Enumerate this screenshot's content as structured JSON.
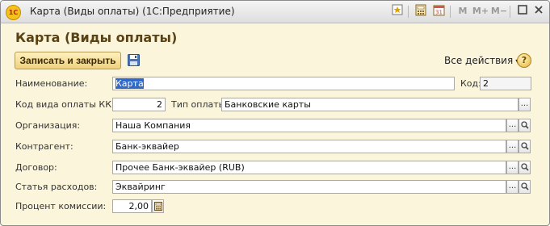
{
  "window": {
    "app_badge": "1С",
    "title": "Карта (Виды оплаты)  (1С:Предприятие)",
    "toolbar": {
      "m_label": "M",
      "m_plus_label": "M+",
      "m_minus_label": "M−",
      "calendar_day": "31"
    }
  },
  "form": {
    "title": "Карта (Виды оплаты)",
    "commands": {
      "save_close_label": "Записать и закрыть",
      "all_actions_label": "Все действия",
      "help_label": "?"
    },
    "fields": {
      "name": {
        "label": "Наименование:",
        "value": "Карта"
      },
      "code": {
        "label": "Код:",
        "value": "2"
      },
      "kkm_code": {
        "label": "Код вида оплаты ККМ:",
        "value": "2"
      },
      "payment_type": {
        "label": "Тип оплаты:",
        "value": "Банковские карты"
      },
      "organization": {
        "label": "Организация:",
        "value": "Наша Компания"
      },
      "counterparty": {
        "label": "Контрагент:",
        "value": "Банк-эквайер"
      },
      "contract": {
        "label": "Договор:",
        "value": "Прочее Банк-эквайер (RUB)"
      },
      "expense_item": {
        "label": "Статья расходов:",
        "value": "Эквайринг"
      },
      "commission": {
        "label": "Процент комиссии:",
        "value": "2,00"
      }
    }
  },
  "icons": {
    "app": "1c-logo-icon",
    "save": "floppy-disk-icon",
    "help": "help-icon",
    "select": "ellipsis-icon",
    "open": "magnifier-icon",
    "calculator": "calculator-icon"
  },
  "colors": {
    "form_bg": "#fbf5dc",
    "title_text": "#5b4213",
    "save_button": "#efd17c",
    "selection": "#3168c5"
  }
}
